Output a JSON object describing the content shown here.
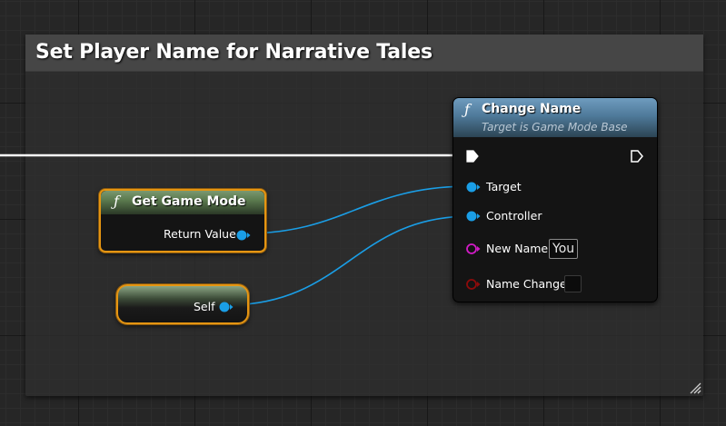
{
  "comment": {
    "title": "Set Player Name for Narrative Tales"
  },
  "nodes": {
    "change_name": {
      "icon": "function-icon",
      "title": "Change Name",
      "subtitle": "Target is Game Mode Base",
      "pins": {
        "target": "Target",
        "controller": "Controller",
        "new_name": "New Name",
        "new_name_value": "You",
        "name_change": "Name Change",
        "name_change_checked": false
      }
    },
    "get_game_mode": {
      "icon": "function-icon",
      "title": "Get Game Mode",
      "pins": {
        "return_value": "Return Value"
      }
    },
    "self": {
      "pins": {
        "self": "Self"
      }
    }
  },
  "colors": {
    "object_pin": "#1a9ee6",
    "text_pin": "#d21bc6",
    "bool_pin": "#8e0b0b",
    "exec_pin": "#ffffff",
    "selection": "#e59512",
    "function_header": "#4f7a9a",
    "pure_header": "#5b7a4e"
  }
}
